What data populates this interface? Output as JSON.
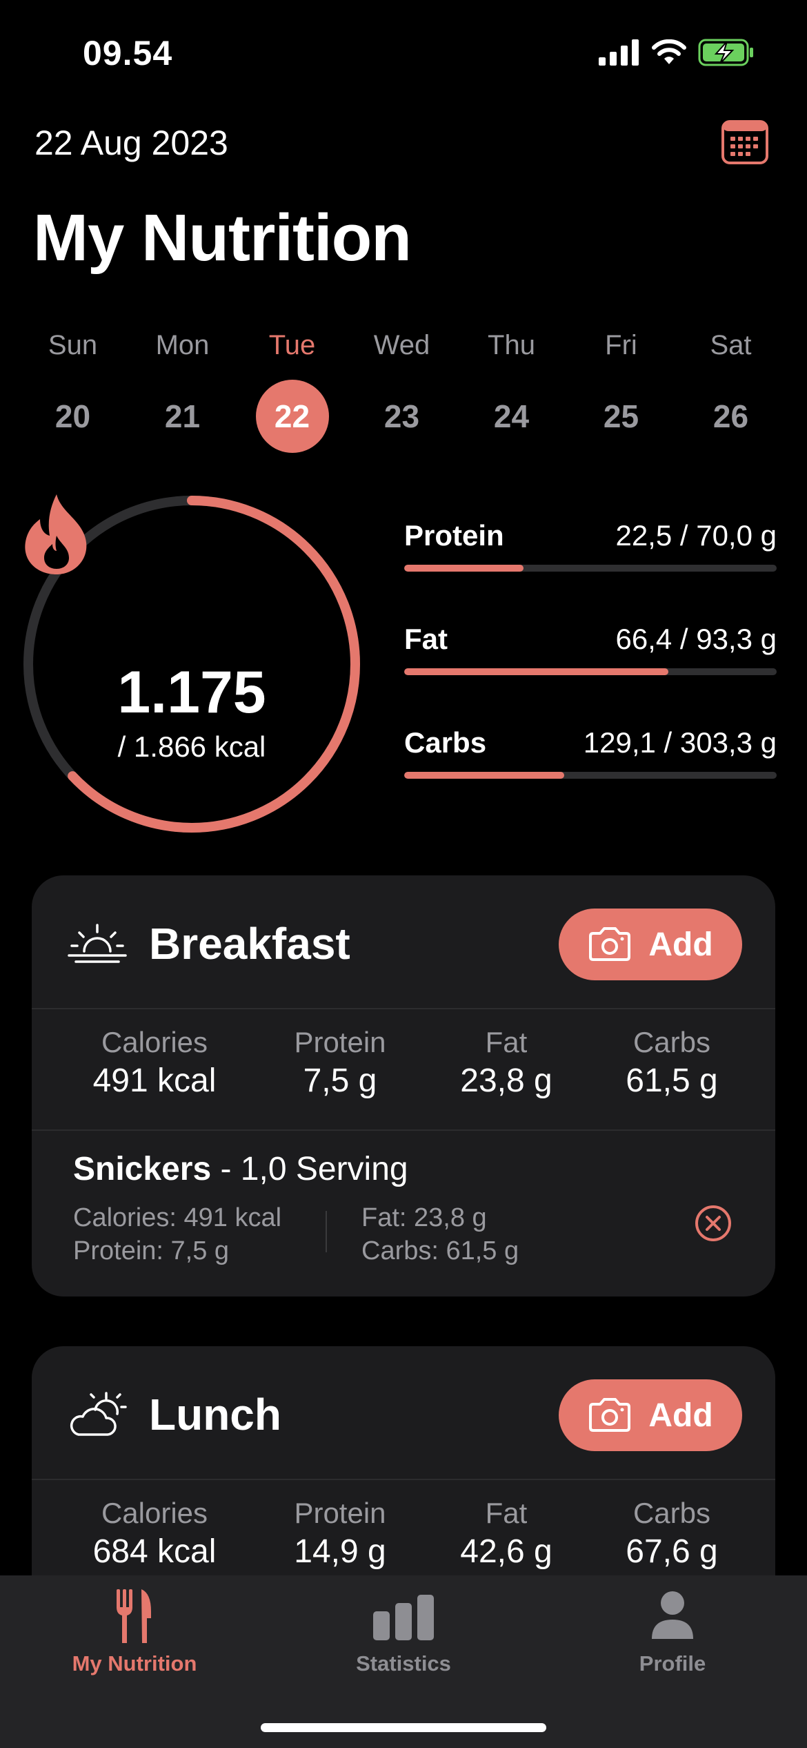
{
  "status_bar": {
    "time": "09.54"
  },
  "header": {
    "date": "22 Aug 2023",
    "title": "My Nutrition"
  },
  "week": [
    {
      "name": "Sun",
      "num": "20"
    },
    {
      "name": "Mon",
      "num": "21"
    },
    {
      "name": "Tue",
      "num": "22",
      "selected": true
    },
    {
      "name": "Wed",
      "num": "23"
    },
    {
      "name": "Thu",
      "num": "24"
    },
    {
      "name": "Fri",
      "num": "25"
    },
    {
      "name": "Sat",
      "num": "26"
    }
  ],
  "summary": {
    "kcal_value": "1.175",
    "kcal_goal": "/ 1.866 kcal",
    "progress": 0.63
  },
  "macros": [
    {
      "name": "Protein",
      "value": "22,5 / 70,0 g",
      "progress": 0.32
    },
    {
      "name": "Fat",
      "value": "66,4 / 93,3 g",
      "progress": 0.71
    },
    {
      "name": "Carbs",
      "value": "129,1 / 303,3 g",
      "progress": 0.43
    }
  ],
  "meals": {
    "breakfast": {
      "title": "Breakfast",
      "add_label": "Add",
      "totals": [
        {
          "label": "Calories",
          "value": "491 kcal"
        },
        {
          "label": "Protein",
          "value": "7,5 g"
        },
        {
          "label": "Fat",
          "value": "23,8 g"
        },
        {
          "label": "Carbs",
          "value": "61,5 g"
        }
      ],
      "foods": [
        {
          "name": "Snickers",
          "serving": " - 1,0 Serving",
          "calories": "Calories: 491 kcal",
          "protein": "Protein: 7,5 g",
          "fat": "Fat: 23,8 g",
          "carbs": "Carbs: 61,5 g"
        }
      ]
    },
    "lunch": {
      "title": "Lunch",
      "add_label": "Add",
      "totals": [
        {
          "label": "Calories",
          "value": "684 kcal"
        },
        {
          "label": "Protein",
          "value": "14,9 g"
        },
        {
          "label": "Fat",
          "value": "42,6 g"
        },
        {
          "label": "Carbs",
          "value": "67,6 g"
        }
      ]
    }
  },
  "tabs": [
    {
      "label": "My Nutrition",
      "icon": "fork-knife-icon",
      "active": true
    },
    {
      "label": "Statistics",
      "icon": "bar-chart-icon"
    },
    {
      "label": "Profile",
      "icon": "person-icon"
    }
  ],
  "colors": {
    "accent": "#e5786d",
    "background": "#000000",
    "card": "#1c1c1e",
    "muted": "#9a9a9f",
    "tabbar": "#242426"
  }
}
